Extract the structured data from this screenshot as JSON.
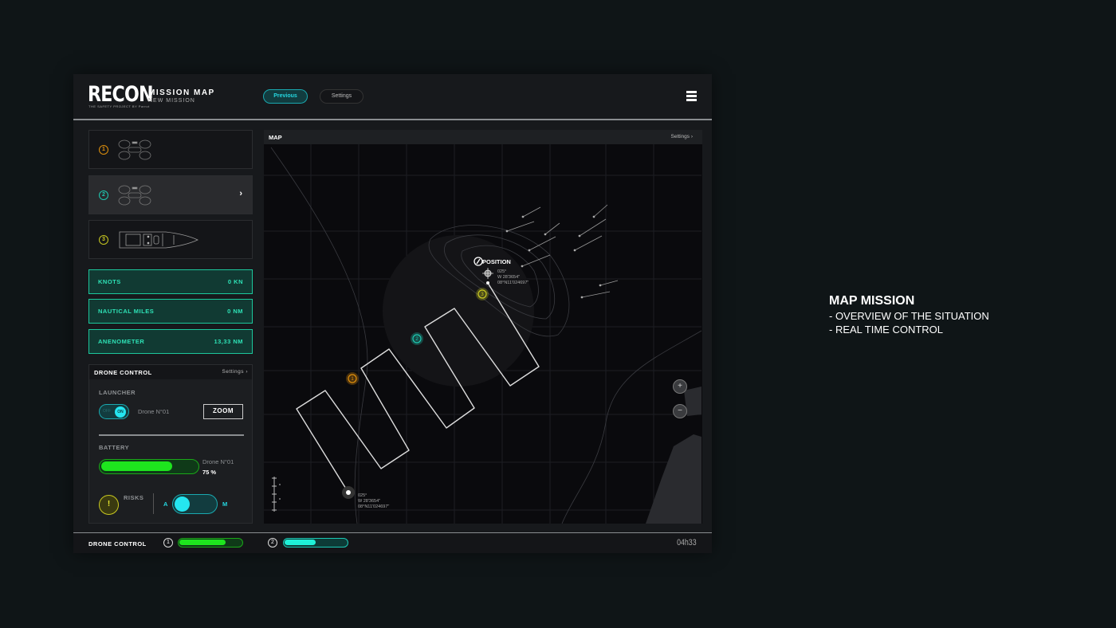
{
  "header": {
    "logo": "RECON",
    "logo_sub": "THE SAFETY PROJECT BY Parrot",
    "title": "MISSION MAP",
    "subtitle": "NEW MISSION",
    "previous_label": "Previous",
    "settings_label": "Settings",
    "menu_icon": "hamburger-icon"
  },
  "vehicles": [
    {
      "num": "1",
      "color": "#e0900c",
      "type": "drone"
    },
    {
      "num": "2",
      "color": "#1fc8b0",
      "type": "drone",
      "selected": true
    },
    {
      "num": "3",
      "color": "#c8c820",
      "type": "boat"
    }
  ],
  "stats": [
    {
      "label": "KNOTS",
      "value": "0 KN"
    },
    {
      "label": "NAUTICAL MILES",
      "value": "0 NM"
    },
    {
      "label": "ANENOMETER",
      "value": "13,33 NM"
    }
  ],
  "drone_control": {
    "title": "DRONE CONTROL",
    "settings": "Settings",
    "launcher_label": "LAUNCHER",
    "toggle_off": "OFF",
    "toggle_on": "ON",
    "drone_name": "Drone N°01",
    "zoom_label": "ZOOM",
    "battery_label": "BATTERY",
    "battery_drone": "Drone N°01",
    "battery_text": "75 %",
    "battery_percent": 75,
    "risks_label": "RISKS",
    "risk_icon": "!",
    "mode_a": "A",
    "mode_m": "M"
  },
  "map": {
    "title": "MAP",
    "settings": "Settings",
    "position_label": "POSITION",
    "position_coords": [
      "025°",
      "W 28'3654\"",
      "08°N11'024697\""
    ],
    "start_coords": [
      "025°",
      "W 28'3654\"",
      "08°N11'024697\""
    ],
    "markers": [
      "1",
      "2",
      "3"
    ]
  },
  "bottom": {
    "title": "DRONE CONTROL",
    "drone1": "1",
    "drone1_percent": 75,
    "drone2": "2",
    "drone2_percent": 50,
    "time": "04h33"
  },
  "caption": {
    "title": "MAP MISSION",
    "line1": "- OVERVIEW OF THE SITUATION",
    "line2": "- REAL TIME CONTROL"
  },
  "colors": {
    "accent": "#1cc79c",
    "cyan": "#25d7e0",
    "green": "#1ee51e"
  }
}
